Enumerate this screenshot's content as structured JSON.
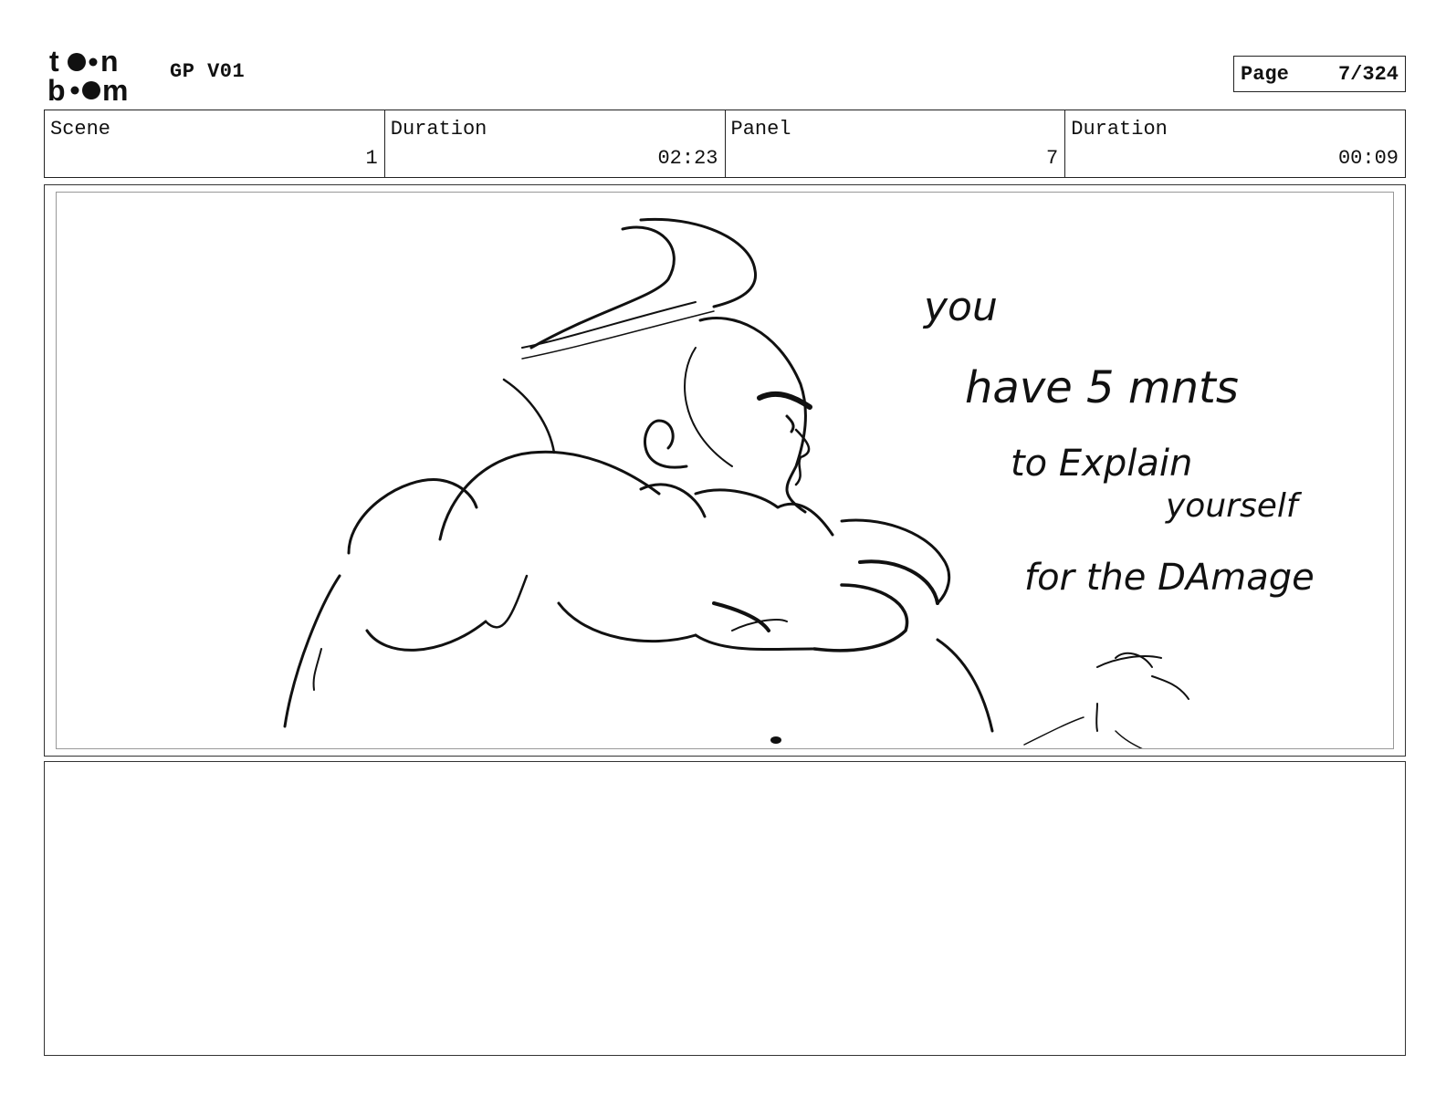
{
  "header": {
    "logo_text": "toon boom",
    "project_title": "GP V01",
    "page_label": "Page",
    "page_number": "7/324"
  },
  "info": {
    "scene_label": "Scene",
    "scene_value": "1",
    "scene_duration_label": "Duration",
    "scene_duration_value": "02:23",
    "panel_label": "Panel",
    "panel_value": "7",
    "panel_duration_label": "Duration",
    "panel_duration_value": "00:09"
  },
  "panel": {
    "handwritten_text": "you have 5 mnts to Explain yourself for the DAmage"
  },
  "notes": {}
}
